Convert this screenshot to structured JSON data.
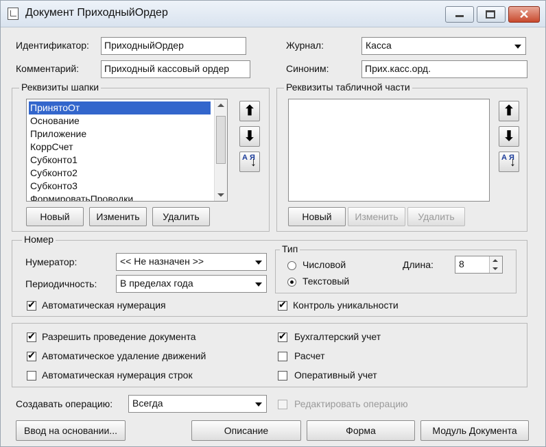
{
  "window": {
    "title": "Документ ПриходныйОрдер"
  },
  "header": {
    "identifier_label": "Идентификатор:",
    "identifier_value": "ПриходныйОрдер",
    "comment_label": "Комментарий:",
    "comment_value": "Приходный кассовый ордер",
    "journal_label": "Журнал:",
    "journal_value": "Касса",
    "synonym_label": "Синоним:",
    "synonym_value": "Прих.касс.орд."
  },
  "header_attrs": {
    "title": "Реквизиты шапки",
    "items": [
      "ПринятоОт",
      "Основание",
      "Приложение",
      "КоррСчет",
      "Субконто1",
      "Субконто2",
      "Субконто3",
      "ФормироватьПроводки"
    ],
    "new_label": "Новый",
    "edit_label": "Изменить",
    "delete_label": "Удалить"
  },
  "table_attrs": {
    "title": "Реквизиты табличной части",
    "new_label": "Новый",
    "edit_label": "Изменить",
    "delete_label": "Удалить"
  },
  "sort_glyph_label": "А Я",
  "number": {
    "title": "Номер",
    "numerator_label": "Нумератор:",
    "numerator_value": "<< Не назначен >>",
    "periodicity_label": "Периодичность:",
    "periodicity_value": "В пределах года",
    "auto_numbering_label": "Автоматическая нумерация",
    "type_title": "Тип",
    "numeric_label": "Числовой",
    "text_label": "Текстовый",
    "length_label": "Длина:",
    "length_value": "8",
    "uniqueness_label": "Контроль уникальности"
  },
  "options": {
    "allow_posting_label": "Разрешить проведение документа",
    "auto_delete_label": "Автоматическое удаление движений",
    "auto_row_numbering_label": "Автоматическая нумерация строк",
    "accounting_label": "Бухгалтерский учет",
    "calculation_label": "Расчет",
    "operational_label": "Оперативный учет"
  },
  "operation": {
    "create_label": "Создавать операцию:",
    "create_value": "Всегда",
    "edit_ops_label": "Редактировать операцию"
  },
  "footer": {
    "basis_label": "Ввод на основании...",
    "description_label": "Описание",
    "form_label": "Форма",
    "module_label": "Модуль Документа"
  }
}
